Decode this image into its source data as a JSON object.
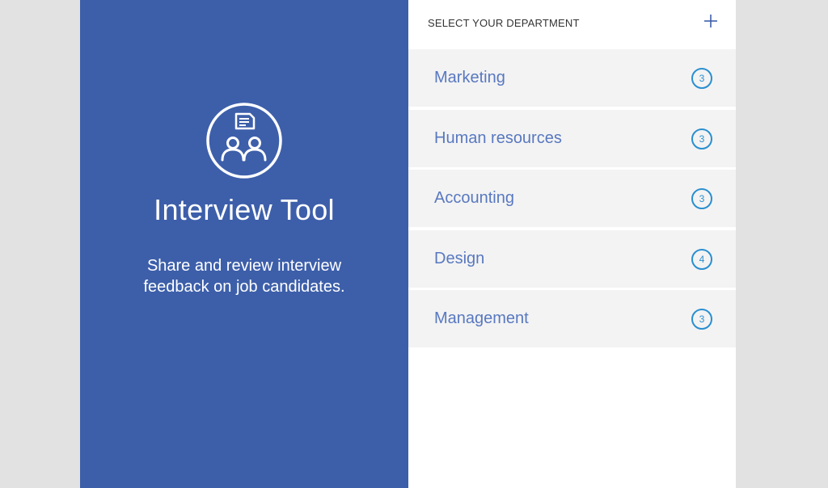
{
  "app": {
    "title": "Interview Tool",
    "description": "Share and review interview feedback on job candidates.",
    "icon": "interview-team-icon"
  },
  "departments": {
    "header": "SELECT YOUR DEPARTMENT",
    "add_icon": "plus-icon",
    "items": [
      {
        "name": "Marketing",
        "count": "3"
      },
      {
        "name": "Human resources",
        "count": "3"
      },
      {
        "name": "Accounting",
        "count": "3"
      },
      {
        "name": "Design",
        "count": "4"
      },
      {
        "name": "Management",
        "count": "3"
      }
    ]
  },
  "colors": {
    "brand_blue": "#3d5faa",
    "dept_text": "#5878c0",
    "badge": "#2a8fd0",
    "row_bg": "#f3f3f3",
    "page_bg": "#e2e2e2"
  }
}
